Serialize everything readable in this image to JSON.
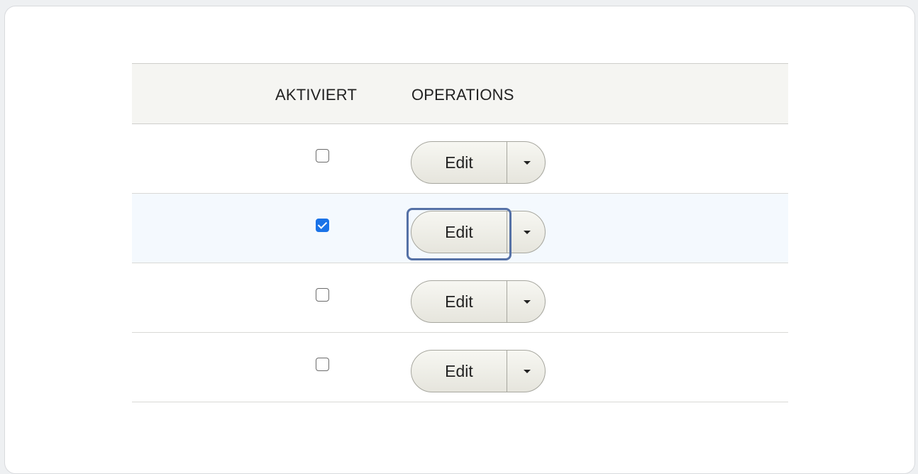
{
  "table": {
    "headers": {
      "enabled": "AKTIVIERT",
      "operations": "OPERATIONS"
    },
    "rows": [
      {
        "enabled": false,
        "edit_label": "Edit",
        "dropdown_icon": "caret-down-icon"
      },
      {
        "enabled": true,
        "edit_label": "Edit",
        "dropdown_icon": "caret-down-icon",
        "highlighted": true
      },
      {
        "enabled": false,
        "edit_label": "Edit",
        "dropdown_icon": "caret-down-icon"
      },
      {
        "enabled": false,
        "edit_label": "Edit",
        "dropdown_icon": "caret-down-icon"
      }
    ]
  },
  "colors": {
    "header_bg": "#f5f5f2",
    "selected_row_bg": "#f4f9fe",
    "checkbox_checked": "#1a73e8",
    "focus_ring": "#5571a6"
  }
}
